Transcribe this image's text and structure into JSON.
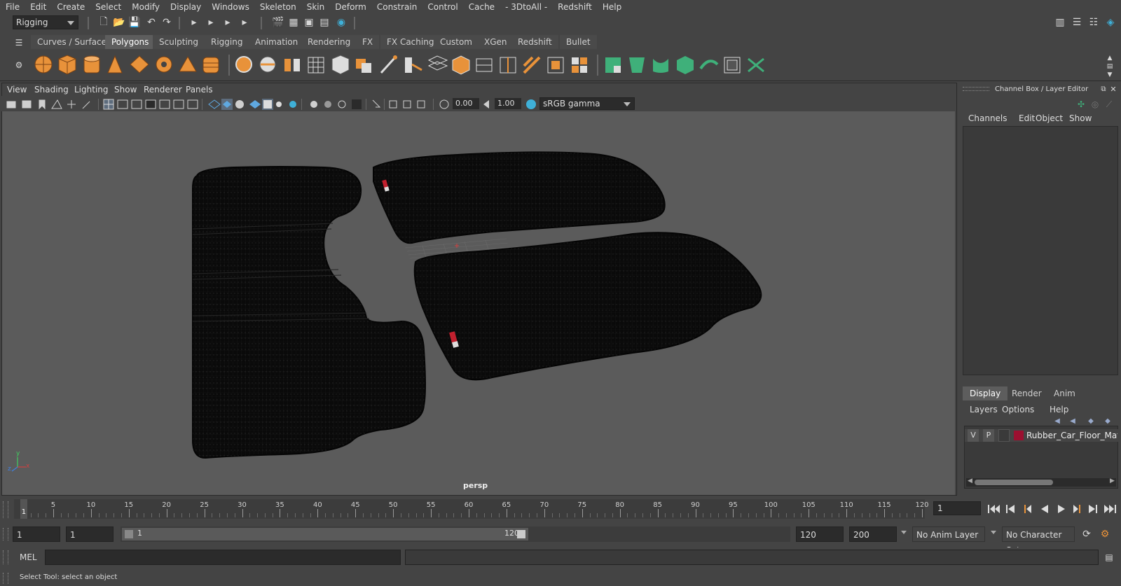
{
  "menubar": [
    "File",
    "Edit",
    "Create",
    "Select",
    "Modify",
    "Display",
    "Windows",
    "Skeleton",
    "Skin",
    "Deform",
    "Constrain",
    "Control",
    "Cache",
    "- 3DtoAll -",
    "Redshift",
    "Help"
  ],
  "status": {
    "menuset": "Rigging"
  },
  "shelf": {
    "tabs": [
      "Curves / Surfaces",
      "Polygons",
      "Sculpting",
      "Rigging",
      "Animation",
      "Rendering",
      "FX",
      "FX Caching",
      "Custom",
      "XGen",
      "Redshift",
      "Bullet"
    ],
    "active_tab": "Polygons"
  },
  "viewport": {
    "menu": [
      "View",
      "Shading",
      "Lighting",
      "Show",
      "Renderer",
      "Panels"
    ],
    "exposure": "0.00",
    "gamma": "1.00",
    "colorspace": "sRGB gamma",
    "camera_label": "persp",
    "axis": {
      "x": "x",
      "y": "y",
      "z": "z"
    }
  },
  "channel_box": {
    "title": "Channel Box / Layer Editor",
    "menu": [
      "Channels",
      "Edit",
      "Object",
      "Show"
    ],
    "tabs": [
      "Display",
      "Render",
      "Anim"
    ],
    "active_tab": "Display",
    "layer_menu": [
      "Layers",
      "Options",
      "Help"
    ],
    "layer": {
      "v": "V",
      "p": "P",
      "name": "Rubber_Car_Floor_Mats_",
      "color": "#9b1030"
    }
  },
  "timeline": {
    "ticks": [
      "5",
      "10",
      "15",
      "20",
      "25",
      "30",
      "35",
      "40",
      "45",
      "50",
      "55",
      "60",
      "65",
      "70",
      "75",
      "80",
      "85",
      "90",
      "95",
      "100",
      "105",
      "110",
      "115",
      "120"
    ],
    "current_marker": "1",
    "current_frame": "1"
  },
  "range": {
    "start": "1",
    "playback_start": "1",
    "range_start_label": "1",
    "range_end_label": "120",
    "playback_end": "120",
    "end": "200",
    "anim_layer": "No Anim Layer",
    "character_set": "No Character Set"
  },
  "command": {
    "lang": "MEL"
  },
  "help": {
    "text": "Select Tool: select an object"
  }
}
